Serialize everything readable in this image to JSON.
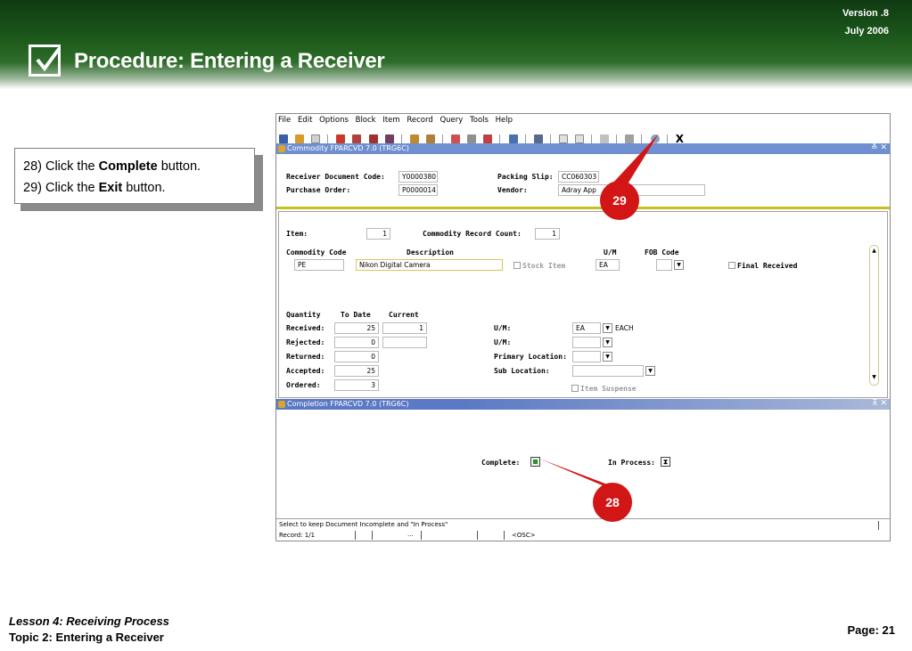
{
  "header": {
    "version": "Version .8",
    "date": "July  2006",
    "title": "Procedure: Entering a Receiver"
  },
  "instructions": {
    "step28_prefix": "28) Click the ",
    "step28_bold": "Complete",
    "step28_suffix": " button.",
    "step29_prefix": "29) Click the ",
    "step29_bold": "Exit",
    "step29_suffix": " button."
  },
  "app": {
    "menu": [
      "File",
      "Edit",
      "Options",
      "Block",
      "Item",
      "Record",
      "Query",
      "Tools",
      "Help"
    ],
    "exit_glyph": "X",
    "commodity_title": "Commodity  FPARCVD  7.0  (TRG6C)",
    "commodity_controls": "≚ ✕",
    "completion_title": "Completion  FPARCVD  7.0  (TRG6C)",
    "completion_controls": "⊼ ✕",
    "header_block": {
      "receiver_doc_label": "Receiver Document Code:",
      "receiver_doc_value": "Y0000380",
      "po_label": "Purchase Order:",
      "po_value": "P0000014",
      "packing_slip_label": "Packing Slip:",
      "packing_slip_value": "CC060303",
      "vendor_label": "Vendor:",
      "vendor_value": "Adray App"
    },
    "item_block": {
      "item_label": "Item:",
      "item_value": "1",
      "record_count_label": "Commodity Record Count:",
      "record_count_value": "1",
      "commodity_code_label": "Commodity Code",
      "description_label": "Description",
      "um_label": "U/M",
      "fob_label": "FOB Code",
      "commodity_code_value": "PE",
      "description_value": "Nikon Digital Camera",
      "stock_item_label": "Stock Item",
      "um_value": "EA",
      "final_received_label": "Final Received"
    },
    "quantity_block": {
      "quantity_label": "Quantity",
      "to_date_label": "To Date",
      "current_label": "Current",
      "received_label": "Received:",
      "received_to_date": "25",
      "received_current": "1",
      "rejected_label": "Rejected:",
      "rejected_to_date": "0",
      "returned_label": "Returned:",
      "returned_to_date": "0",
      "accepted_label": "Accepted:",
      "accepted_to_date": "25",
      "ordered_label": "Ordered:",
      "ordered_to_date": "3",
      "um1_label": "U/M:",
      "um1_value": "EA",
      "um1_desc": "EACH",
      "um2_label": "U/M:",
      "primary_location_label": "Primary Location:",
      "sub_location_label": "Sub Location:",
      "item_suspense_label": "Item  Suspense"
    },
    "completion": {
      "complete_label": "Complete:",
      "in_process_label": "In Process:",
      "in_process_glyph": "⧗"
    },
    "status": {
      "message": "Select to keep Document Incomplete and \"In Process\"",
      "record": "Record: 1/1",
      "ellipsis": "...",
      "osc": "<OSC>"
    }
  },
  "callouts": {
    "c29": "29",
    "c28": "28"
  },
  "footer": {
    "lesson": "Lesson 4: Receiving Process",
    "topic": "Topic 2: Entering a Receiver",
    "page": "Page: 21"
  },
  "colors": {
    "header_green": "#1d5a1c",
    "callout_red": "#d21515",
    "titlebar_blue": "#6f8fd0"
  }
}
